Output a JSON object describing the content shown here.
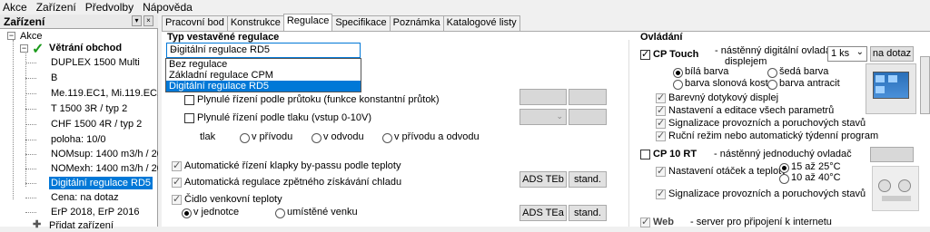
{
  "menu": [
    "Akce",
    "Zařízení",
    "Předvolby",
    "Nápověda"
  ],
  "left_panel": {
    "title": "Zařízení",
    "tree": {
      "root": "Akce",
      "device": "Větrání obchod",
      "items": [
        "DUPLEX 1500 Multi",
        "B",
        "Me.119.EC1, Mi.119.EC1",
        "T 1500 3R / typ 2",
        "CHF 1500 4R / typ 2",
        "poloha: 10/0",
        "NOMsup: 1400 m3/h / 200 Pa",
        "NOMexh: 1400 m3/h / 200 Pa",
        "Digitální regulace RD5",
        "Cena: na dotaz",
        "ErP 2018, ErP 2016"
      ],
      "add": "Přidat zařízení"
    }
  },
  "tabs": [
    "Pracovní bod",
    "Konstrukce",
    "Regulace",
    "Specifikace",
    "Poznámka",
    "Katalogové listy"
  ],
  "regulation": {
    "type_label": "Typ vestavěné regulace",
    "selected": "Digitální regulace RD5",
    "options": [
      "Bez regulace",
      "Základní regulace CPM",
      "Digitální regulace RD5"
    ],
    "flow_control": "Plynulé řízení podle průtoku (funkce konstantní průtok)",
    "pressure_control": "Plynulé řízení podle tlaku (vstup 0-10V)",
    "pressure_label": "tlak",
    "pressure_options": [
      "v přívodu",
      "v odvodu",
      "v přívodu a odvodu"
    ],
    "bypass": "Automatické řízení klapky by-passu podle teploty",
    "recovery": "Automatická regulace zpětného získávání chladu",
    "ads_teb": "ADS TEb",
    "stand1": "stand.",
    "outdoor_sensor": "Čidlo venkovní teploty",
    "in_unit": "v jednotce",
    "outdoor": "umístěné venku",
    "ads_tea": "ADS TEa",
    "stand2": "stand."
  },
  "controls": {
    "title": "Ovládání",
    "cp_touch": "CP Touch",
    "cp_touch_desc1": "- nástěnný digitální ovladač s",
    "cp_touch_desc2": "displejem",
    "qty": "1 ks",
    "na_dotaz": "na dotaz",
    "colors": [
      "bílá barva",
      "šedá barva",
      "barva slonová kost",
      "barva antracit"
    ],
    "touch_features": [
      "Barevný dotykový displej",
      "Nastavení a editace všech parametrů",
      "Signalizace provozních a poruchových stavů",
      "Ruční režim nebo automatický týdenní program"
    ],
    "cp10": "CP 10 RT",
    "cp10_desc": "- nástěnný jednoduchý ovladač",
    "cp10_setting": "Nastavení otáček a teploty",
    "temps": [
      "15 až 25°C",
      "10 až 40°C"
    ],
    "cp10_signal": "Signalizace provozních a poruchových stavů",
    "web": "Web",
    "web_desc": "- server pro připojení k internetu"
  }
}
